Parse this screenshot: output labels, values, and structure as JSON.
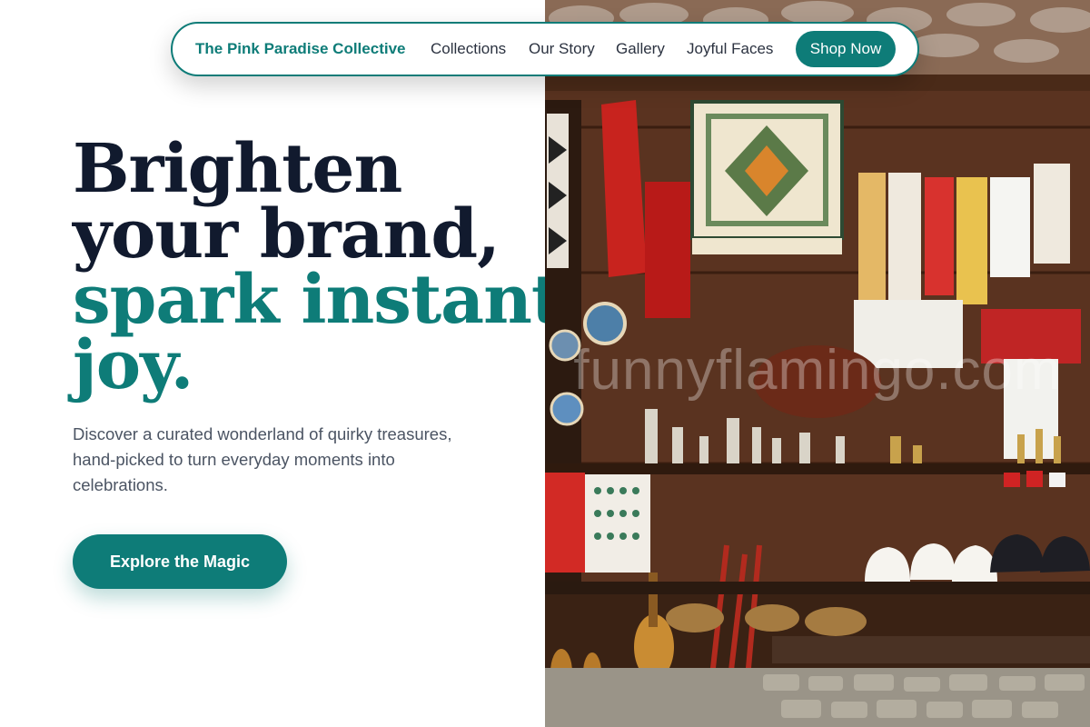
{
  "nav": {
    "brand": "The Pink Paradise Collective",
    "links": [
      "Collections",
      "Our Story",
      "Gallery",
      "Joyful Faces"
    ],
    "shop_label": "Shop Now"
  },
  "hero": {
    "title_line1": "Brighten",
    "title_line2": "your brand,",
    "title_accent_line1": "spark instant",
    "title_accent_line2": "joy.",
    "subtitle": "Discover a curated wonderland of quirky treasures, hand-picked to turn everyday moments into celebrations.",
    "cta_label": "Explore the Magic"
  },
  "image": {
    "watermark": "funnyflamingo.com"
  },
  "colors": {
    "accent": "#0e7c78",
    "heading": "#111a2e",
    "body_text": "#4b5463"
  }
}
